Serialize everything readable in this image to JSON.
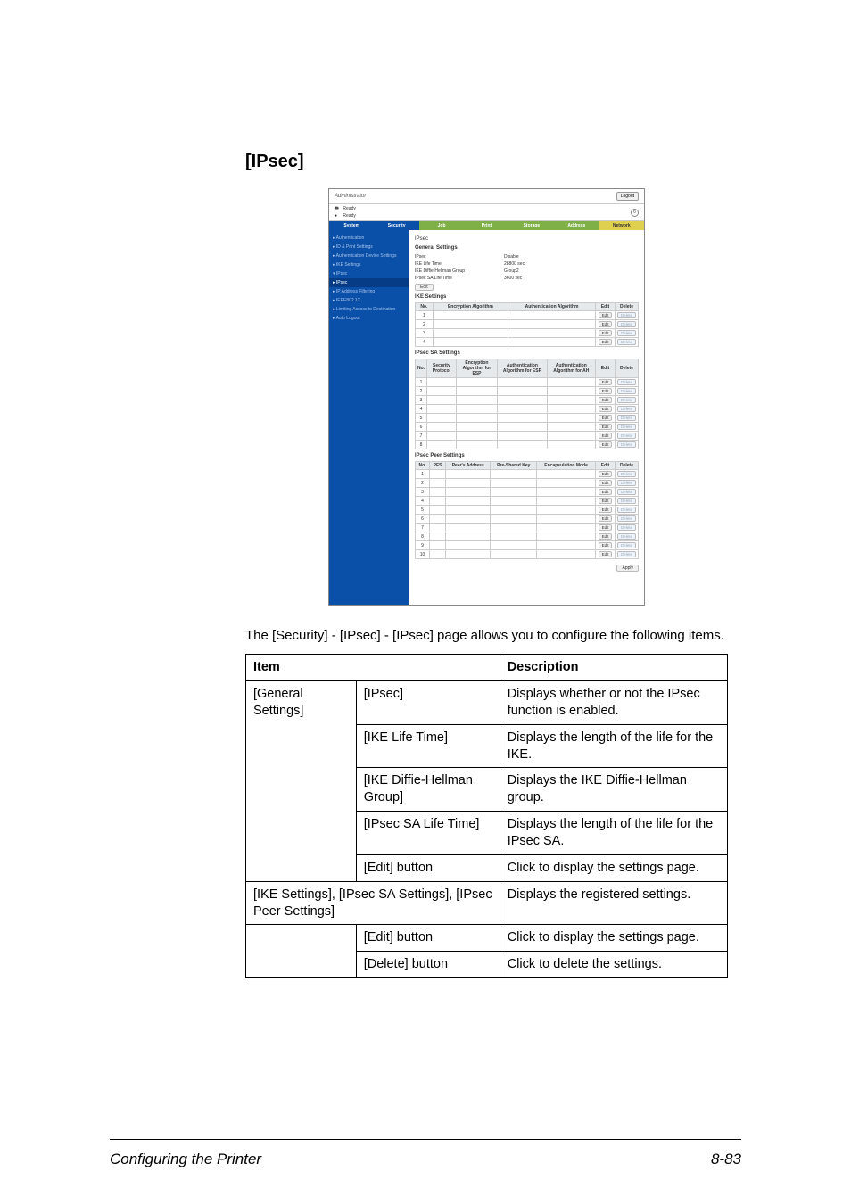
{
  "heading": "[IPsec]",
  "intro": "The [Security] - [IPsec] - [IPsec] page allows you to configure the following items.",
  "desc_table": {
    "headers": {
      "item": "Item",
      "description": "Description"
    },
    "rows": [
      {
        "c1": "[General Settings]",
        "c2": "[IPsec]",
        "c3": "Displays whether or not the IPsec function is enabled.",
        "rowspan1": 5
      },
      {
        "c2": "[IKE Life Time]",
        "c3": "Displays the length of the life for the IKE."
      },
      {
        "c2": "[IKE Diffie-Hellman Group]",
        "c3": "Displays the IKE Diffie-Hellman group."
      },
      {
        "c2": "[IPsec SA Life Time]",
        "c3": "Displays the length of the life for the IPsec SA."
      },
      {
        "c2": "[Edit] button",
        "c3": "Click to display the settings page."
      },
      {
        "c1": "[IKE Settings], [IPsec SA Settings], [IPsec Peer Settings]",
        "c3": "Displays the registered settings.",
        "colspan12": true
      },
      {
        "c1": "",
        "c2": "[Edit] button",
        "c3": "Click to display the settings page.",
        "rowspan1": 2
      },
      {
        "c2": "[Delete] button",
        "c3": "Click to delete the settings."
      }
    ]
  },
  "footer": {
    "left": "Configuring the Printer",
    "right": "8-83"
  },
  "screenshot": {
    "logo": "Administrator",
    "logout": "Logout",
    "status_ready_label": "Ready",
    "status_ready_icon": "printer-icon",
    "status_toner_label": "Ready",
    "status_toner_icon": "toner-icon",
    "refresh": "↻",
    "tabs": [
      "System",
      "Security",
      "Job",
      "Print",
      "Storage",
      "Address",
      "Network"
    ],
    "sidebar": [
      "▸ Authentication",
      "▸ ID & Print Settings",
      "▸ Authentication Device Settings",
      "▸ IKE Settings",
      "▾ IPsec",
      "   ▸ IPsec",
      "▸ IP Address Filtering",
      "▸ IEEE802.1X",
      "▸ Limiting Access to Destination",
      "▸ Auto Logout"
    ],
    "active_sidebar_index": 5,
    "main": {
      "title": "IPsec",
      "general": {
        "subtitle": "General Settings",
        "rows": [
          {
            "k": "IPsec",
            "v": "Disable"
          },
          {
            "k": "IKE Life Time",
            "v": "28800 sec"
          },
          {
            "k": "IKE Diffie-Hellman Group",
            "v": "Group2"
          },
          {
            "k": "IPsec SA Life Time",
            "v": "3600 sec"
          }
        ],
        "edit": "Edit"
      },
      "ike": {
        "subtitle": "IKE Settings",
        "headers": [
          "No.",
          "Encryption Algorithm",
          "Authentication Algorithm",
          "Edit",
          "Delete"
        ],
        "count": 4
      },
      "sa": {
        "subtitle": "IPsec SA Settings",
        "headers": [
          "No.",
          "Security Protocol",
          "Encryption Algorithm for ESP",
          "Authentication Algorithm for ESP",
          "Authentication Algorithm for AH",
          "Edit",
          "Delete"
        ],
        "count": 8
      },
      "peer": {
        "subtitle": "IPsec Peer Settings",
        "headers": [
          "No.",
          "PFS",
          "Peer's Address",
          "Pre-Shared Key",
          "Encapsulation Mode",
          "Edit",
          "Delete"
        ],
        "count": 10
      },
      "edit_btn": "Edit",
      "delete_btn": "Delete",
      "apply": "Apply"
    }
  }
}
